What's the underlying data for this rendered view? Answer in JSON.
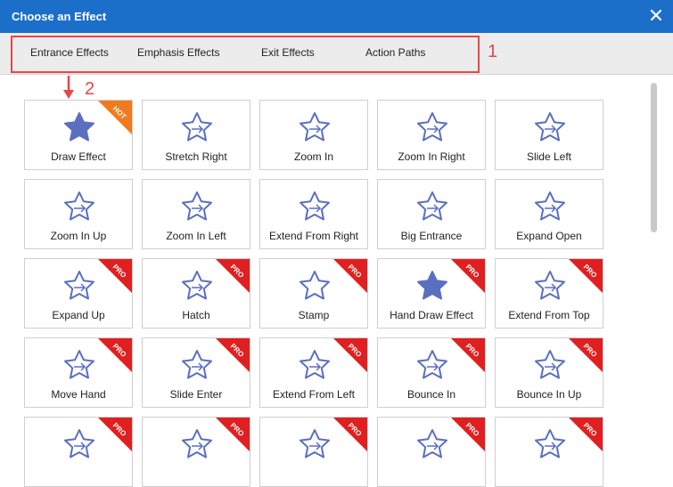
{
  "dialog": {
    "title": "Choose an Effect"
  },
  "tabs": [
    {
      "label": "Entrance Effects"
    },
    {
      "label": "Emphasis Effects"
    },
    {
      "label": "Exit Effects"
    },
    {
      "label": "Action Paths"
    }
  ],
  "annotations": {
    "box_number": "1",
    "arrow_number": "2",
    "color": "#e84646"
  },
  "colors": {
    "titlebar": "#1c6fc9",
    "star": "#5b6fc1",
    "pro_badge": "#e02020",
    "hot_badge": "#f07b1e"
  },
  "effects": [
    {
      "label": "Draw Effect",
      "badge": "HOT",
      "icon": "hand-draw-star-icon"
    },
    {
      "label": "Stretch Right",
      "badge": "",
      "icon": "stretch-right-star-icon"
    },
    {
      "label": "Zoom In",
      "badge": "",
      "icon": "zoom-in-star-icon"
    },
    {
      "label": "Zoom In Right",
      "badge": "",
      "icon": "zoom-in-right-star-icon"
    },
    {
      "label": "Slide Left",
      "badge": "",
      "icon": "slide-left-star-icon"
    },
    {
      "label": "Zoom In Up",
      "badge": "",
      "icon": "zoom-in-up-star-icon"
    },
    {
      "label": "Zoom In Left",
      "badge": "",
      "icon": "zoom-in-left-star-icon"
    },
    {
      "label": "Extend From Right",
      "badge": "",
      "icon": "extend-from-right-star-icon"
    },
    {
      "label": "Big Entrance",
      "badge": "",
      "icon": "big-entrance-star-icon"
    },
    {
      "label": "Expand Open",
      "badge": "",
      "icon": "expand-open-star-icon"
    },
    {
      "label": "Expand Up",
      "badge": "PRO",
      "icon": "expand-up-star-icon"
    },
    {
      "label": "Hatch",
      "badge": "PRO",
      "icon": "hatch-star-icon"
    },
    {
      "label": "Stamp",
      "badge": "PRO",
      "icon": "stamp-icon"
    },
    {
      "label": "Hand Draw Effect",
      "badge": "PRO",
      "icon": "hand-draw-brush-icon"
    },
    {
      "label": "Extend From Top",
      "badge": "PRO",
      "icon": "extend-from-top-star-icon"
    },
    {
      "label": "Move Hand",
      "badge": "PRO",
      "icon": "move-hand-star-icon"
    },
    {
      "label": "Slide Enter",
      "badge": "PRO",
      "icon": "slide-enter-star-icon"
    },
    {
      "label": "Extend From Left",
      "badge": "PRO",
      "icon": "extend-from-left-star-icon"
    },
    {
      "label": "Bounce In",
      "badge": "PRO",
      "icon": "bounce-in-star-icon"
    },
    {
      "label": "Bounce In Up",
      "badge": "PRO",
      "icon": "bounce-in-up-star-icon"
    },
    {
      "label": "",
      "badge": "PRO",
      "icon": "glow-star-icon"
    },
    {
      "label": "",
      "badge": "PRO",
      "icon": "slide-horizontal-star-icon"
    },
    {
      "label": "",
      "badge": "PRO",
      "icon": "slide-left-bounded-star-icon"
    },
    {
      "label": "",
      "badge": "PRO",
      "icon": "move-up-star-icon"
    },
    {
      "label": "",
      "badge": "PRO",
      "icon": "zoom-pop-star-icon"
    }
  ]
}
